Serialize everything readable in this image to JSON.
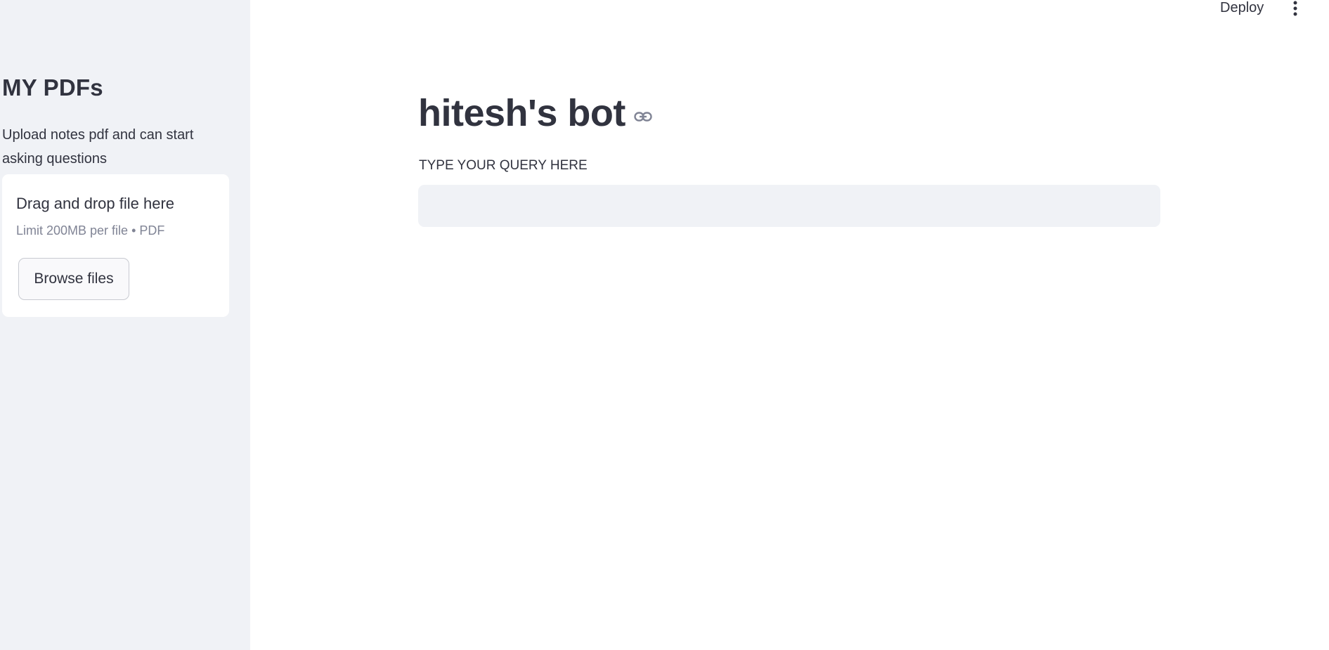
{
  "header": {
    "deploy_label": "Deploy",
    "menu_icon": "vertical-dots-icon"
  },
  "sidebar": {
    "title": "MY PDFs",
    "description": "Upload notes pdf and can start asking questions",
    "uploader": {
      "title": "Drag and drop file here",
      "limit": "Limit 200MB per file • PDF",
      "browse_label": "Browse files"
    }
  },
  "main": {
    "title": "hitesh's bot",
    "title_icon": "link-icon",
    "query": {
      "label": "TYPE YOUR QUERY HERE",
      "value": "",
      "placeholder": ""
    }
  },
  "colors": {
    "sidebar_bg": "#f0f2f6",
    "text": "#31333f",
    "muted_text": "#808495",
    "input_bg": "#f0f2f6"
  }
}
